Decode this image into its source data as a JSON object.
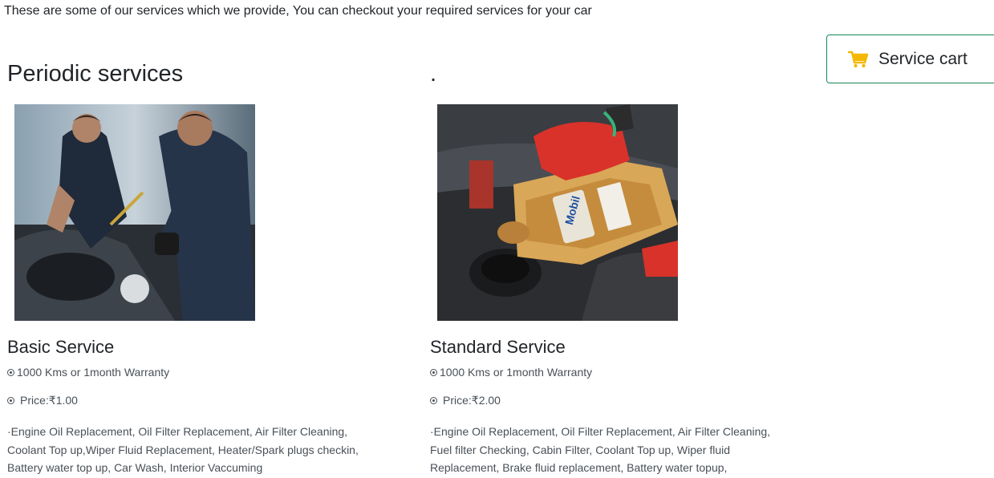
{
  "intro_text": "These are some of our services which we provide, You can checkout your required services for your car",
  "section_title": "Periodic services",
  "column2_title": ".",
  "cart_button": {
    "label": "Service cart",
    "icon": "shopping-cart-icon",
    "icon_color": "#f5b800",
    "border_color": "#198754"
  },
  "services": [
    {
      "image": "mechanics-working-on-engine-photo",
      "title": "Basic Service",
      "warranty": "1000 Kms or 1month Warranty",
      "price": "Price:₹1.00",
      "description": "·Engine Oil Replacement, Oil Filter Replacement, Air Filter Cleaning, Coolant Top up,Wiper Fluid Replacement, Heater/Spark plugs checkin, Battery water top up, Car Wash, Interior Vaccuming"
    },
    {
      "image": "pouring-engine-oil-photo",
      "title": "Standard Service",
      "warranty": "1000 Kms or 1month Warranty",
      "price": "Price:₹2.00",
      "description": "·Engine Oil Replacement, Oil Filter Replacement, Air Filter Cleaning, Fuel filter Checking, Cabin Filter, Coolant Top up, Wiper fluid Replacement, Brake fluid replacement, Battery water topup,"
    }
  ]
}
